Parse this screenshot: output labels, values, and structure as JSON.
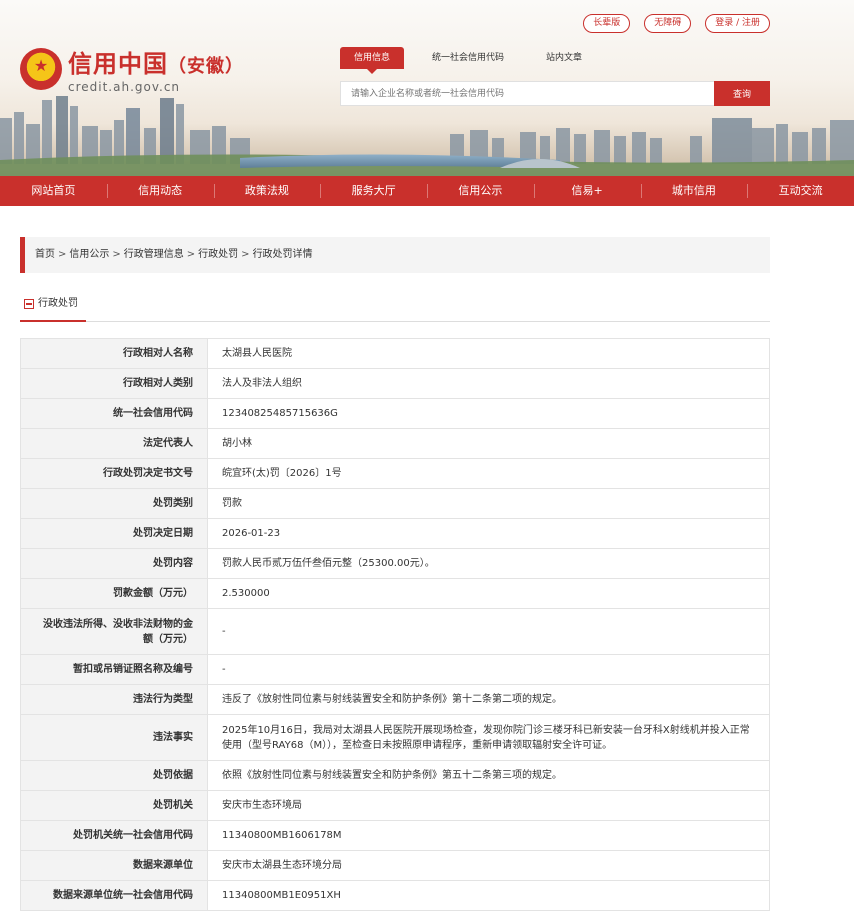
{
  "top_links": [
    "长辈版",
    "无障碍",
    "登录 / 注册"
  ],
  "logo": {
    "title": "信用中国",
    "region": "（安徽）",
    "url": "credit.ah.gov.cn"
  },
  "search": {
    "tabs": [
      "信用信息",
      "统一社会信用代码",
      "站内文章"
    ],
    "placeholder": "请输入企业名称或者统一社会信用代码",
    "button": "查询"
  },
  "nav": [
    "网站首页",
    "信用动态",
    "政策法规",
    "服务大厅",
    "信用公示",
    "信易+",
    "城市信用",
    "互动交流"
  ],
  "breadcrumb": [
    "首页",
    "信用公示",
    "行政管理信息",
    "行政处罚",
    "行政处罚详情"
  ],
  "section_title": "行政处罚",
  "rows": [
    {
      "label": "行政相对人名称",
      "value": "太湖县人民医院"
    },
    {
      "label": "行政相对人类别",
      "value": "法人及非法人组织"
    },
    {
      "label": "统一社会信用代码",
      "value": "12340825485715636G"
    },
    {
      "label": "法定代表人",
      "value": "胡小林"
    },
    {
      "label": "行政处罚决定书文号",
      "value": "皖宜环(太)罚〔2026〕1号"
    },
    {
      "label": "处罚类别",
      "value": "罚款"
    },
    {
      "label": "处罚决定日期",
      "value": "2026-01-23"
    },
    {
      "label": "处罚内容",
      "value": "罚款人民币贰万伍仟叁佰元整（25300.00元）。"
    },
    {
      "label": "罚款金额（万元）",
      "value": "2.530000"
    },
    {
      "label": "没收违法所得、没收非法财物的金额（万元）",
      "value": "-"
    },
    {
      "label": "暂扣或吊销证照名称及编号",
      "value": "-"
    },
    {
      "label": "违法行为类型",
      "value": "违反了《放射性同位素与射线装置安全和防护条例》第十二条第二项的规定。"
    },
    {
      "label": "违法事实",
      "value": "2025年10月16日，我局对太湖县人民医院开展现场检查，发现你院门诊三楼牙科已新安装一台牙科X射线机并投入正常使用（型号RAY68（M）），至检查日未按照原申请程序，重新申请领取辐射安全许可证。"
    },
    {
      "label": "处罚依据",
      "value": "依照《放射性同位素与射线装置安全和防护条例》第五十二条第三项的规定。"
    },
    {
      "label": "处罚机关",
      "value": "安庆市生态环境局"
    },
    {
      "label": "处罚机关统一社会信用代码",
      "value": "11340800MB1606178M"
    },
    {
      "label": "数据来源单位",
      "value": "安庆市太湖县生态环境分局"
    },
    {
      "label": "数据来源单位统一社会信用代码",
      "value": "11340800MB1E0951XH"
    }
  ],
  "colors": {
    "primary": "#c9302c",
    "label_bg": "#f3f3f3",
    "border": "#e3e3e3"
  }
}
